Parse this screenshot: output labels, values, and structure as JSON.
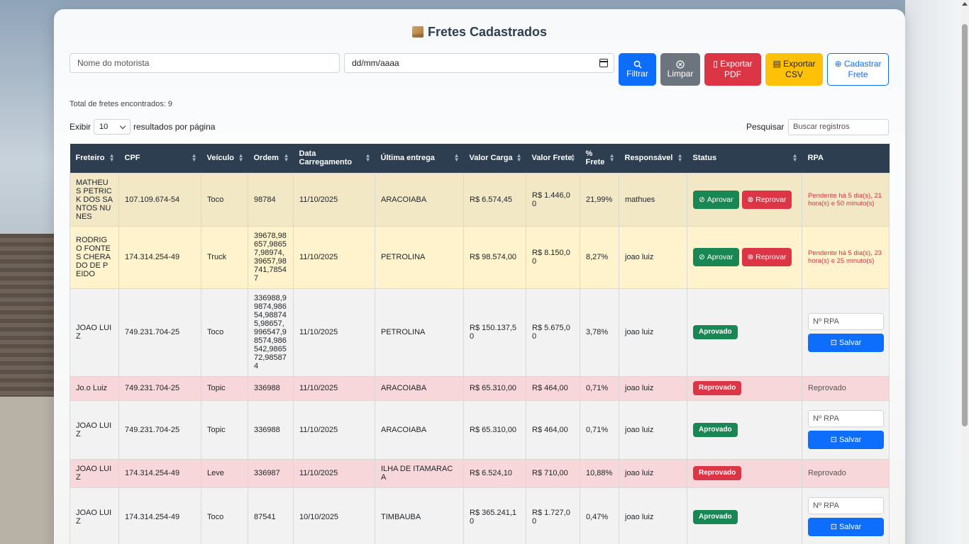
{
  "page": {
    "title": "Fretes Cadastrados"
  },
  "filters": {
    "driver_placeholder": "Nome do motorista",
    "date_placeholder": "dd/mm/aaaa",
    "filter_label": "Filtrar",
    "clear_label": "Limpar",
    "export_pdf_label": "Exportar PDF",
    "export_csv_label": "Exportar CSV",
    "register_label": "Cadastrar Frete"
  },
  "summary": {
    "total_text": "Total de fretes encontrados: 9",
    "show_label": "Exibir",
    "page_size": "10",
    "per_page_label": "resultados por página",
    "search_label": "Pesquisar",
    "search_placeholder": "Buscar registros"
  },
  "table": {
    "headers": [
      "Freteiro",
      "CPF",
      "Veículo",
      "Ordem",
      "Data Carregamento",
      "Última entrega",
      "Valor Carga",
      "Valor Frete",
      "% Frete",
      "Responsável",
      "Status",
      "RPA"
    ],
    "approve_label": "Aprovar",
    "reject_label": "Reprovar",
    "approved_badge": "Aprovado",
    "rejected_badge": "Reprovado",
    "rejected_rpa_text": "Reprovado",
    "rpa_placeholder": "Nº RPA",
    "save_label": "Salvar",
    "rows": [
      {
        "freteiro": "MATHEUS PETRICK DOS SANTOS NUNES",
        "cpf": "107.109.674-54",
        "veiculo": "Toco",
        "ordem": "98784",
        "data": "11/10/2025",
        "entrega": "ARACOIABA",
        "carga": "R$ 6.574,45",
        "frete": "R$ 1.446,00",
        "pct": "21,99%",
        "resp": "mathues",
        "status": "pending",
        "rpa": "Pendente há 5 dia(s), 21 hora(s) e 50 minuto(s)"
      },
      {
        "freteiro": "RODRIGO FONTES CHERADO DE PEIDO",
        "cpf": "174.314.254-49",
        "veiculo": "Truck",
        "ordem": "39678,98657,98657,98974,39657,98741,78547",
        "data": "11/10/2025",
        "entrega": "PETROLINA",
        "carga": "R$ 98.574,00",
        "frete": "R$ 8.150,00",
        "pct": "8,27%",
        "resp": "joao luiz",
        "status": "pending",
        "rpa": "Pendente há 5 dia(s), 23 hora(s) e 25 minuto(s)"
      },
      {
        "freteiro": "JOAO LUIZ",
        "cpf": "749.231.704-25",
        "veiculo": "Toco",
        "ordem": "336988,99874,98654,988745,98657,996547,98574,986542,986572,985874",
        "data": "11/10/2025",
        "entrega": "PETROLINA",
        "carga": "R$ 150.137,50",
        "frete": "R$ 5.675,00",
        "pct": "3,78%",
        "resp": "joao luiz",
        "status": "approved",
        "rpa": ""
      },
      {
        "freteiro": "Jo.o Luiz",
        "cpf": "749.231.704-25",
        "veiculo": "Topic",
        "ordem": "336988",
        "data": "11/10/2025",
        "entrega": "ARACOIABA",
        "carga": "R$ 65.310,00",
        "frete": "R$ 464,00",
        "pct": "0,71%",
        "resp": "joao luiz",
        "status": "rejected",
        "rpa": ""
      },
      {
        "freteiro": "JOAO LUIZ",
        "cpf": "749.231.704-25",
        "veiculo": "Topic",
        "ordem": "336988",
        "data": "11/10/2025",
        "entrega": "ARACOIABA",
        "carga": "R$ 65.310,00",
        "frete": "R$ 464,00",
        "pct": "0,71%",
        "resp": "joao luiz",
        "status": "approved",
        "rpa": ""
      },
      {
        "freteiro": "JOAO LUIZ",
        "cpf": "174.314.254-49",
        "veiculo": "Leve",
        "ordem": "336987",
        "data": "11/10/2025",
        "entrega": "ILHA DE ITAMARACA",
        "carga": "R$ 6.524,10",
        "frete": "R$ 710,00",
        "pct": "10,88%",
        "resp": "joao luiz",
        "status": "rejected",
        "rpa": ""
      },
      {
        "freteiro": "JOAO LUIZ",
        "cpf": "174.314.254-49",
        "veiculo": "Toco",
        "ordem": "87541",
        "data": "10/10/2025",
        "entrega": "TIMBAUBA",
        "carga": "R$ 365.241,10",
        "frete": "R$ 1.727,00",
        "pct": "0,47%",
        "resp": "joao luiz",
        "status": "approved",
        "rpa": ""
      }
    ]
  },
  "colors": {
    "header_bg": "#2c3e50",
    "primary": "#0d6efd",
    "success": "#198754",
    "danger": "#dc3545",
    "warning": "#ffc107"
  }
}
